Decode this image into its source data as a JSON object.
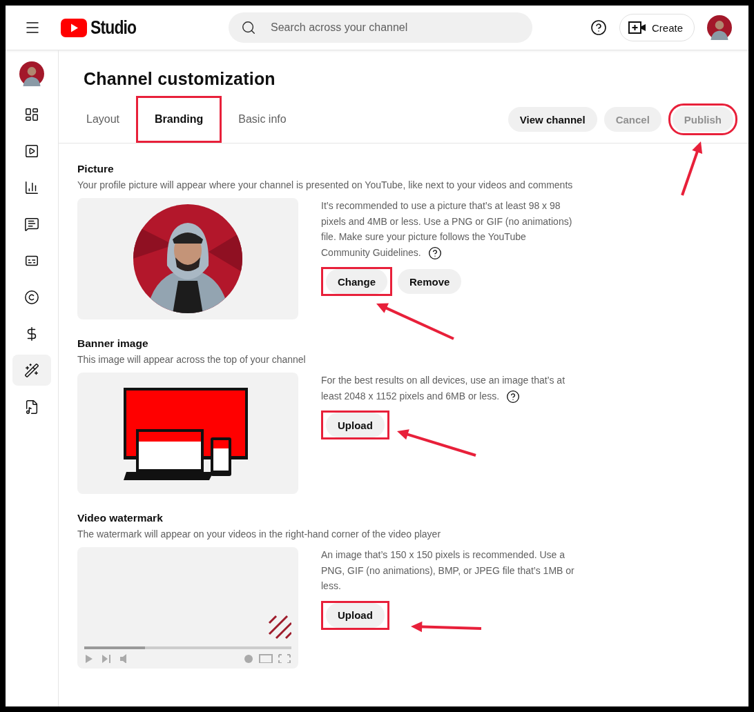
{
  "header": {
    "logo_text": "Studio",
    "search": {
      "placeholder": "Search across your channel"
    },
    "create_label": "Create"
  },
  "sidebar": {
    "items": [
      {
        "selected": false
      },
      {
        "selected": false
      },
      {
        "selected": false
      },
      {
        "selected": false
      },
      {
        "selected": false
      },
      {
        "selected": false
      },
      {
        "selected": false
      },
      {
        "selected": true
      },
      {
        "selected": false
      }
    ]
  },
  "page": {
    "title": "Channel customization",
    "tabs": [
      {
        "label": "Layout",
        "selected": false,
        "highlighted": false
      },
      {
        "label": "Branding",
        "selected": true,
        "highlighted": true
      },
      {
        "label": "Basic info",
        "selected": false,
        "highlighted": false
      }
    ],
    "actions": [
      {
        "label": "View channel",
        "disabled": false,
        "highlighted": false
      },
      {
        "label": "Cancel",
        "disabled": true,
        "highlighted": false
      },
      {
        "label": "Publish",
        "disabled": true,
        "highlighted": true
      }
    ]
  },
  "sections": [
    {
      "kind": "picture",
      "heading": "Picture",
      "description": "Your profile picture will appear where your channel is presented on YouTube, like next to your videos and comments",
      "info": "It’s recommended to use a picture that’s at least 98 x 98 pixels and 4MB or less. Use a PNG or GIF (no animations) file. Make sure your picture follows the YouTube Community Guidelines.",
      "help": true,
      "buttons": [
        {
          "label": "Change",
          "highlighted": true
        },
        {
          "label": "Remove",
          "highlighted": false
        }
      ]
    },
    {
      "kind": "banner",
      "heading": "Banner image",
      "description": "This image will appear across the top of your channel",
      "info": "For the best results on all devices, use an image that’s at least 2048 x 1152 pixels and 6MB or less.",
      "help": true,
      "buttons": [
        {
          "label": "Upload",
          "highlighted": true
        }
      ]
    },
    {
      "kind": "watermark",
      "heading": "Video watermark",
      "description": "The watermark will appear on your videos in the right-hand corner of the video player",
      "info": "An image that’s 150 x 150 pixels is recommended. Use a PNG, GIF (no animations), BMP, or JPEG file that’s 1MB or less.",
      "help": false,
      "buttons": [
        {
          "label": "Upload",
          "highlighted": true
        }
      ]
    }
  ]
}
